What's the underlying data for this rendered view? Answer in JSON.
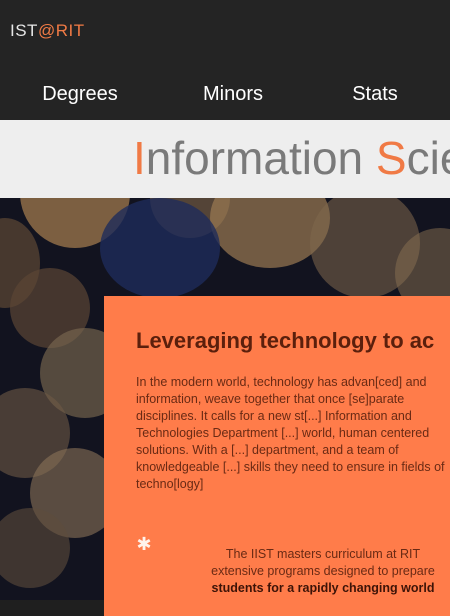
{
  "header": {
    "logo_part1": "IST",
    "logo_part2": "@RIT"
  },
  "nav": {
    "items": [
      {
        "label": "Degrees"
      },
      {
        "label": "Minors"
      },
      {
        "label": "Stats"
      }
    ]
  },
  "title": {
    "cap1": "I",
    "rest1": "nformation ",
    "cap2": "S",
    "rest2": "cience"
  },
  "card": {
    "heading": "Leveraging technology to ac",
    "paragraph": "In the modern world, technology has advan[ced] and information, weave together that once [se]parate disciplines. It calls for a new st[...] Information and Technologies Department [...] world, human centered solutions. With a [...] department, and a team of knowledgeable [...] skills they need to ensure in fields of techno[logy]",
    "note_line1": "The IIST masters curriculum at RIT",
    "note_line2": "extensive programs designed to prepare",
    "note_line3": "students for a rapidly changing world"
  },
  "colors": {
    "accent": "#f07a45",
    "card_bg": "#ff7c4a",
    "header_bg": "#242424",
    "title_band_bg": "#eeeeee"
  }
}
